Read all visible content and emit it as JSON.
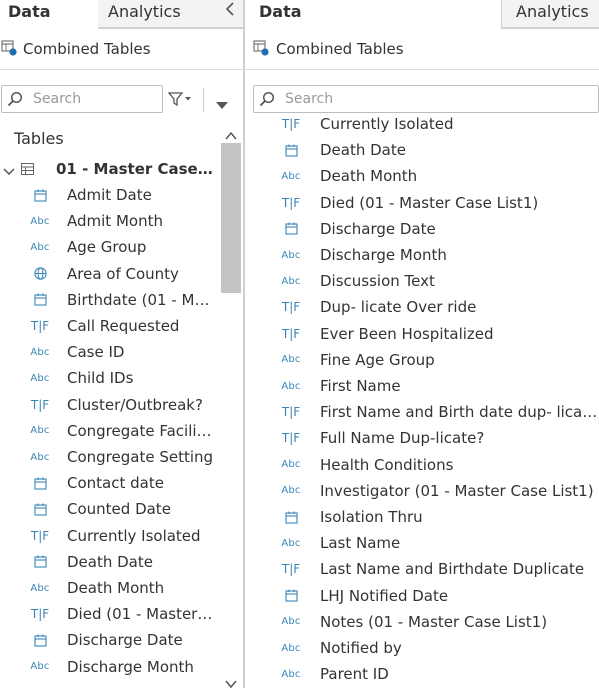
{
  "left": {
    "tabs": {
      "data": "Data",
      "analytics": "Analytics"
    },
    "connection": "Combined Tables",
    "search_placeholder": "Search",
    "tables_heading": "Tables",
    "table_name": "01 - Master Case Li...",
    "fields": [
      {
        "type": "date",
        "label": "Admit Date"
      },
      {
        "type": "abc",
        "label": "Admit Month"
      },
      {
        "type": "abc",
        "label": "Age Group"
      },
      {
        "type": "geo",
        "label": "Area of County"
      },
      {
        "type": "date",
        "label": "Birthdate (01 - Ma..."
      },
      {
        "type": "tf",
        "label": "Call Requested"
      },
      {
        "type": "abc",
        "label": "Case ID"
      },
      {
        "type": "abc",
        "label": "Child IDs"
      },
      {
        "type": "tf",
        "label": "Cluster/Outbreak?"
      },
      {
        "type": "abc",
        "label": "Congregate Facilit..."
      },
      {
        "type": "abc",
        "label": "Congregate Setting"
      },
      {
        "type": "date",
        "label": "Contact date"
      },
      {
        "type": "date",
        "label": "Counted Date"
      },
      {
        "type": "tf",
        "label": "Currently Isolated"
      },
      {
        "type": "date",
        "label": "Death Date"
      },
      {
        "type": "abc",
        "label": "Death Month"
      },
      {
        "type": "tf",
        "label": "Died (01 - Master ..."
      },
      {
        "type": "date",
        "label": "Discharge Date"
      },
      {
        "type": "abc",
        "label": "Discharge Month"
      }
    ]
  },
  "right": {
    "tabs": {
      "data": "Data",
      "analytics": "Analytics"
    },
    "connection": "Combined Tables",
    "search_placeholder": "Search",
    "fields": [
      {
        "type": "tf",
        "label": "Currently Isolated"
      },
      {
        "type": "date",
        "label": "Death Date"
      },
      {
        "type": "abc",
        "label": "Death Month"
      },
      {
        "type": "tf",
        "label": "Died (01 - Master Case List1)"
      },
      {
        "type": "date",
        "label": "Discharge Date"
      },
      {
        "type": "abc",
        "label": "Discharge Month"
      },
      {
        "type": "abc",
        "label": "Discussion Text"
      },
      {
        "type": "tf",
        "label": "Dup- licate Over ride"
      },
      {
        "type": "tf",
        "label": "Ever Been Hospitalized"
      },
      {
        "type": "abc",
        "label": "Fine Age Group"
      },
      {
        "type": "abc",
        "label": "First Name"
      },
      {
        "type": "tf",
        "label": "First Name and Birth date dup- licate?"
      },
      {
        "type": "tf",
        "label": "Full Name Dup-licate?"
      },
      {
        "type": "abc",
        "label": "Health Conditions"
      },
      {
        "type": "abc",
        "label": "Investigator (01 - Master Case List1)"
      },
      {
        "type": "date",
        "label": "Isolation Thru"
      },
      {
        "type": "abc",
        "label": "Last Name"
      },
      {
        "type": "tf",
        "label": "Last Name and Birthdate Duplicate"
      },
      {
        "type": "date",
        "label": "LHJ Notified Date"
      },
      {
        "type": "abc",
        "label": "Notes (01 - Master Case List1)"
      },
      {
        "type": "abc",
        "label": "Notified by"
      },
      {
        "type": "abc",
        "label": "Parent ID"
      }
    ]
  },
  "icon_glyphs": {
    "abc": "Abc",
    "tf": "T|F"
  },
  "colors": {
    "icon_blue": "#3a85b8",
    "scroll_thumb": "#c4c4c4",
    "border": "#cfcfcf"
  }
}
